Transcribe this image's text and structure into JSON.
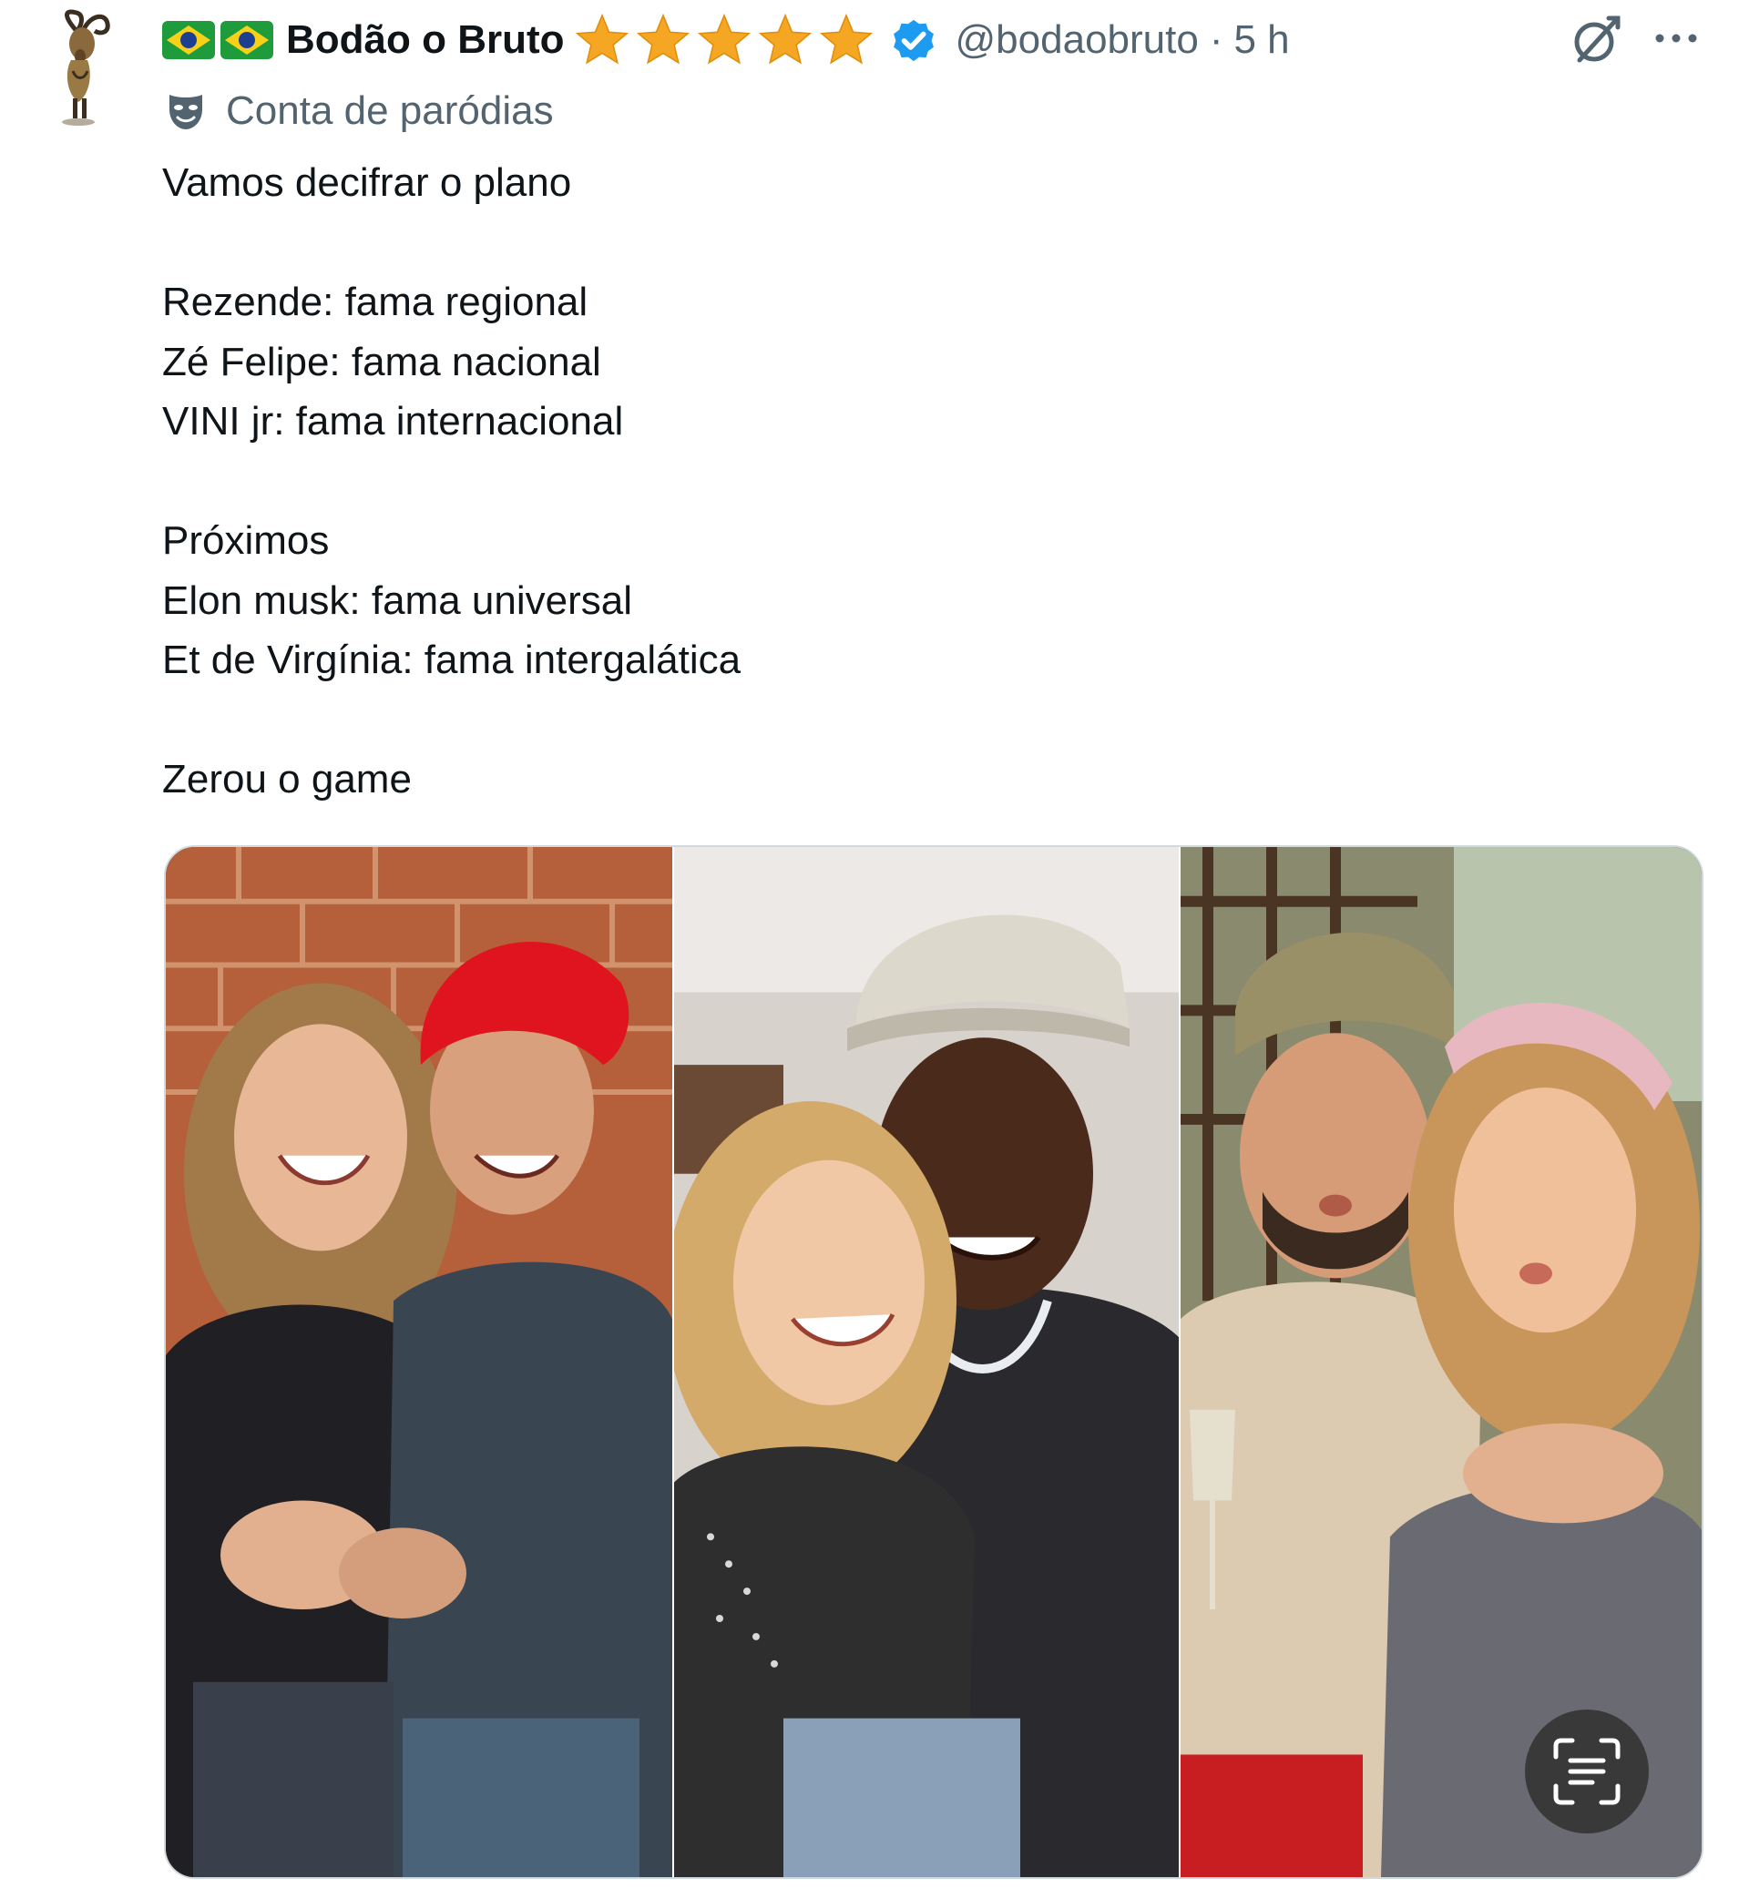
{
  "author": {
    "display_name": "Bodão o Bruto",
    "handle": "@bodaobruto",
    "separator": "·",
    "timestamp": "5 h",
    "flag_icon": "brazil-flag-icon",
    "star_count": 5,
    "star_icon": "star-icon",
    "verified_icon": "verified-badge-icon",
    "avatar_icon": "goat-avatar-icon"
  },
  "parody": {
    "label": "Conta de paródias",
    "icon": "theater-mask-icon"
  },
  "actions": {
    "grok_icon": "grok-icon",
    "more_icon": "more-options-icon"
  },
  "tweet": {
    "lines": [
      "Vamos decifrar o plano",
      "",
      "Rezende: fama regional",
      "Zé Felipe: fama nacional",
      "VINI jr: fama internacional",
      "",
      "Próximos",
      "Elon musk: fama universal",
      "Et de Virgínia: fama intergalática",
      "",
      "Zerou o game"
    ]
  },
  "media": {
    "photo_count": 3,
    "ocr_icon": "text-scan-icon"
  },
  "colors": {
    "text_primary": "#0f1419",
    "text_secondary": "#536471",
    "verified_blue": "#1d9bf0",
    "star_gold": "#f5a623",
    "border": "#cfd9de"
  }
}
